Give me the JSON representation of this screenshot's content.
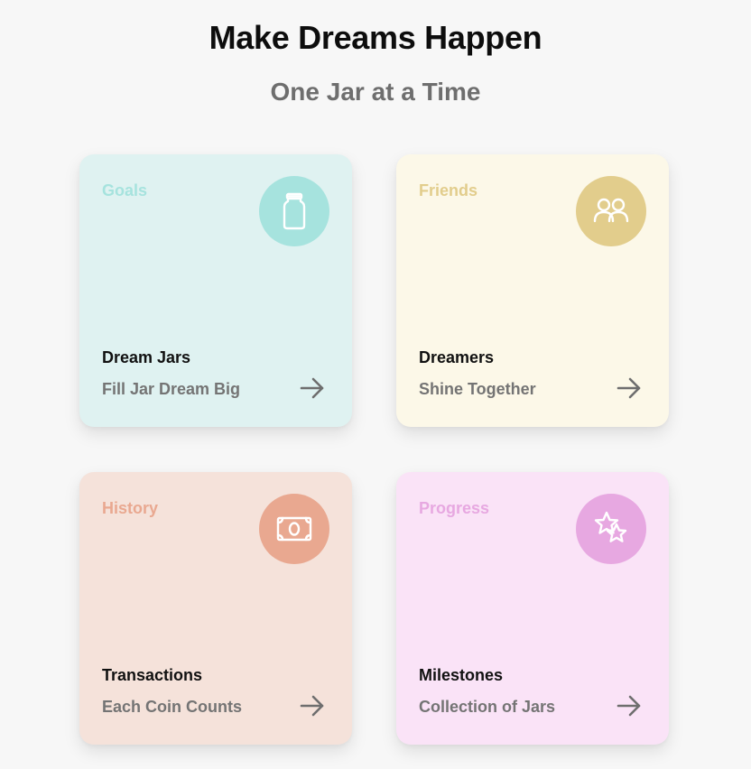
{
  "header": {
    "title": "Make Dreams Happen",
    "subtitle": "One Jar at a Time"
  },
  "cards": [
    {
      "tag": "Goals",
      "heading": "Dream Jars",
      "subtext": "Fill Jar Dream Big",
      "icon": "jar-icon",
      "bg": "#dff2f1",
      "accent": "#a6e3de",
      "tag_color": "#a6e3de"
    },
    {
      "tag": "Friends",
      "heading": "Dreamers",
      "subtext": "Shine Together",
      "icon": "people-icon",
      "bg": "#fcf8e8",
      "accent": "#e2cd8c",
      "tag_color": "#e2cd8c"
    },
    {
      "tag": "History",
      "heading": "Transactions",
      "subtext": "Each Coin Counts",
      "icon": "money-icon",
      "bg": "#f5e2da",
      "accent": "#e9a890",
      "tag_color": "#e9a890"
    },
    {
      "tag": "Progress",
      "heading": "Milestones",
      "subtext": "Collection of Jars",
      "icon": "stars-icon",
      "bg": "#fae3f7",
      "accent": "#e7a8e1",
      "tag_color": "#e7a8e1"
    }
  ]
}
